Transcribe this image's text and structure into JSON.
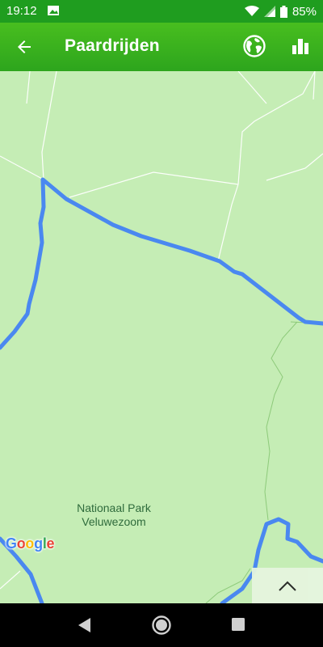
{
  "status_bar": {
    "time": "19:12",
    "battery_text": "85%",
    "icons": [
      "image-icon",
      "wifi-icon",
      "cell-signal-icon",
      "battery-icon"
    ]
  },
  "app_bar": {
    "title": "Paardrijden",
    "icons": [
      "back-arrow-icon",
      "globe-icon",
      "bar-chart-icon"
    ]
  },
  "map": {
    "park_label_line1": "Nationaal Park",
    "park_label_line2": "Veluwezoom",
    "route_color": "#4a88f0",
    "background_color": "#c5edb5"
  },
  "google_logo": {
    "letters": [
      "G",
      "o",
      "o",
      "g",
      "l",
      "e"
    ],
    "colors": [
      "#4285f4",
      "#ea4335",
      "#fbbc05",
      "#4285f4",
      "#34a853",
      "#ea4335"
    ]
  },
  "expand_button": {
    "icon": "chevron-up-icon"
  },
  "nav_bar": {
    "icons": [
      "back-triangle-icon",
      "home-circle-icon",
      "recents-square-icon"
    ]
  }
}
